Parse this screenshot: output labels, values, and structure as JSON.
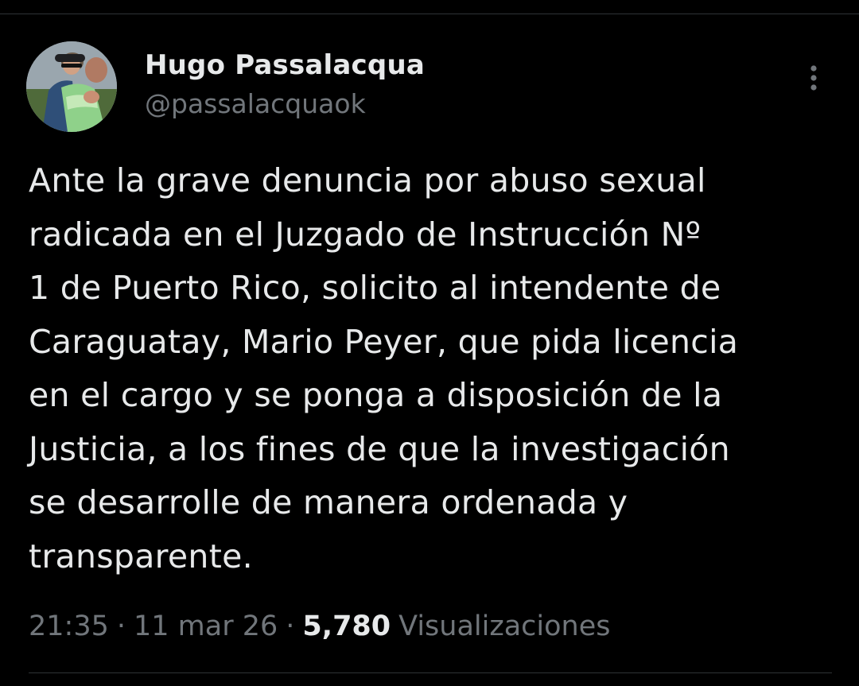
{
  "tweet": {
    "author": {
      "display_name": "Hugo Passalacqua",
      "handle": "@passalacquaok"
    },
    "text": "Ante la grave denuncia por abuso sexual\nradicada en el Juzgado de Instrucción Nº\n1 de Puerto Rico, solicito al intendente de\nCaraguatay, Mario Peyer, que pida licencia\nen el cargo y se ponga a disposición de la\nJusticia, a los fines de que la investigación\nse desarrolle de manera ordenada y\ntransparente.",
    "time": "21:35",
    "separator": "·",
    "date": "11 mar 26",
    "views_count": "5,780",
    "views_label": "Visualizaciones"
  },
  "icons": {
    "more": "more-vertical-icon"
  },
  "colors": {
    "background": "#000000",
    "primary_text": "#e7e9ea",
    "secondary_text": "#71767b",
    "divider": "#2f3336"
  }
}
